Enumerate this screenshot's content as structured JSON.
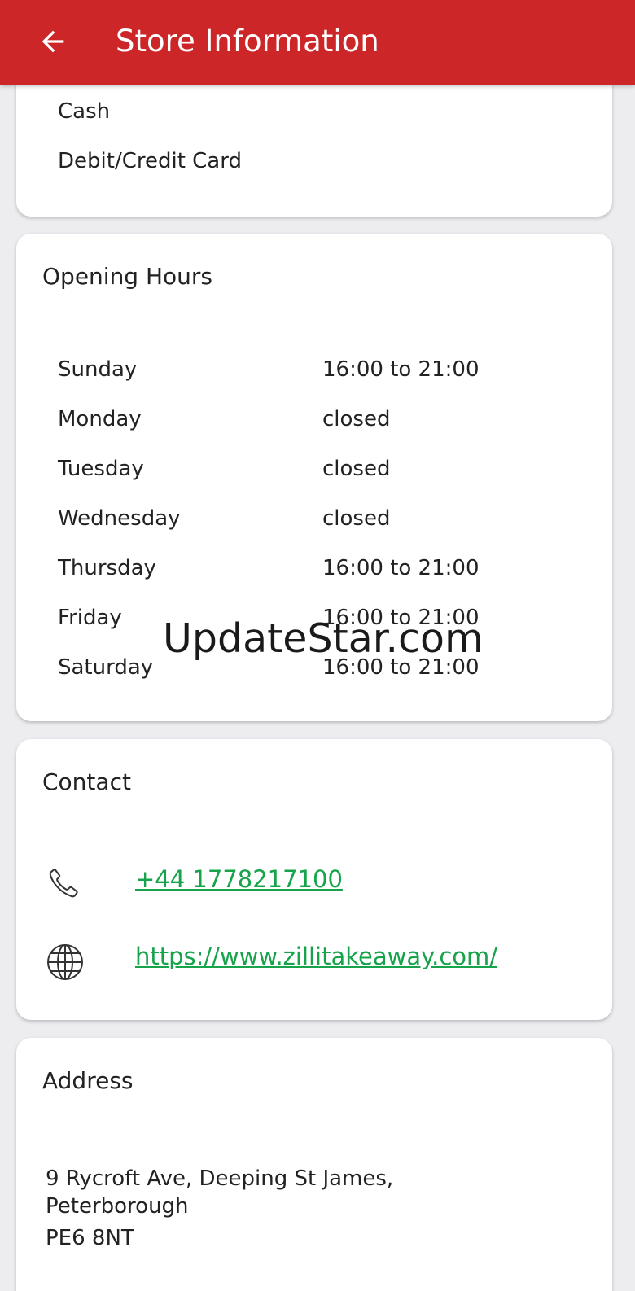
{
  "appbar": {
    "title": "Store Information",
    "back_icon": "arrow-left-icon"
  },
  "payment": {
    "methods": [
      "Cash",
      "Debit/Credit Card"
    ]
  },
  "opening_hours": {
    "title": "Opening Hours",
    "days": [
      {
        "day": "Sunday",
        "hours": "16:00 to 21:00"
      },
      {
        "day": "Monday",
        "hours": "closed"
      },
      {
        "day": "Tuesday",
        "hours": "closed"
      },
      {
        "day": "Wednesday",
        "hours": "closed"
      },
      {
        "day": "Thursday",
        "hours": "16:00 to 21:00"
      },
      {
        "day": "Friday",
        "hours": "16:00 to 21:00"
      },
      {
        "day": "Saturday",
        "hours": "16:00 to 21:00"
      }
    ]
  },
  "contact": {
    "title": "Contact",
    "phone": "+44 1778217100",
    "website": "https://www.zillitakeaway.com/",
    "phone_icon": "phone-icon",
    "website_icon": "globe-icon",
    "link_color": "#16a34a"
  },
  "address": {
    "title": "Address",
    "lines": [
      "9 Rycroft Ave, Deeping St James,",
      "Peterborough",
      "PE6 8NT"
    ]
  },
  "watermark": {
    "text": "UpdateStar.com"
  },
  "colors": {
    "appbar": "#cc2628",
    "background": "#ededf0",
    "card": "#ffffff"
  }
}
